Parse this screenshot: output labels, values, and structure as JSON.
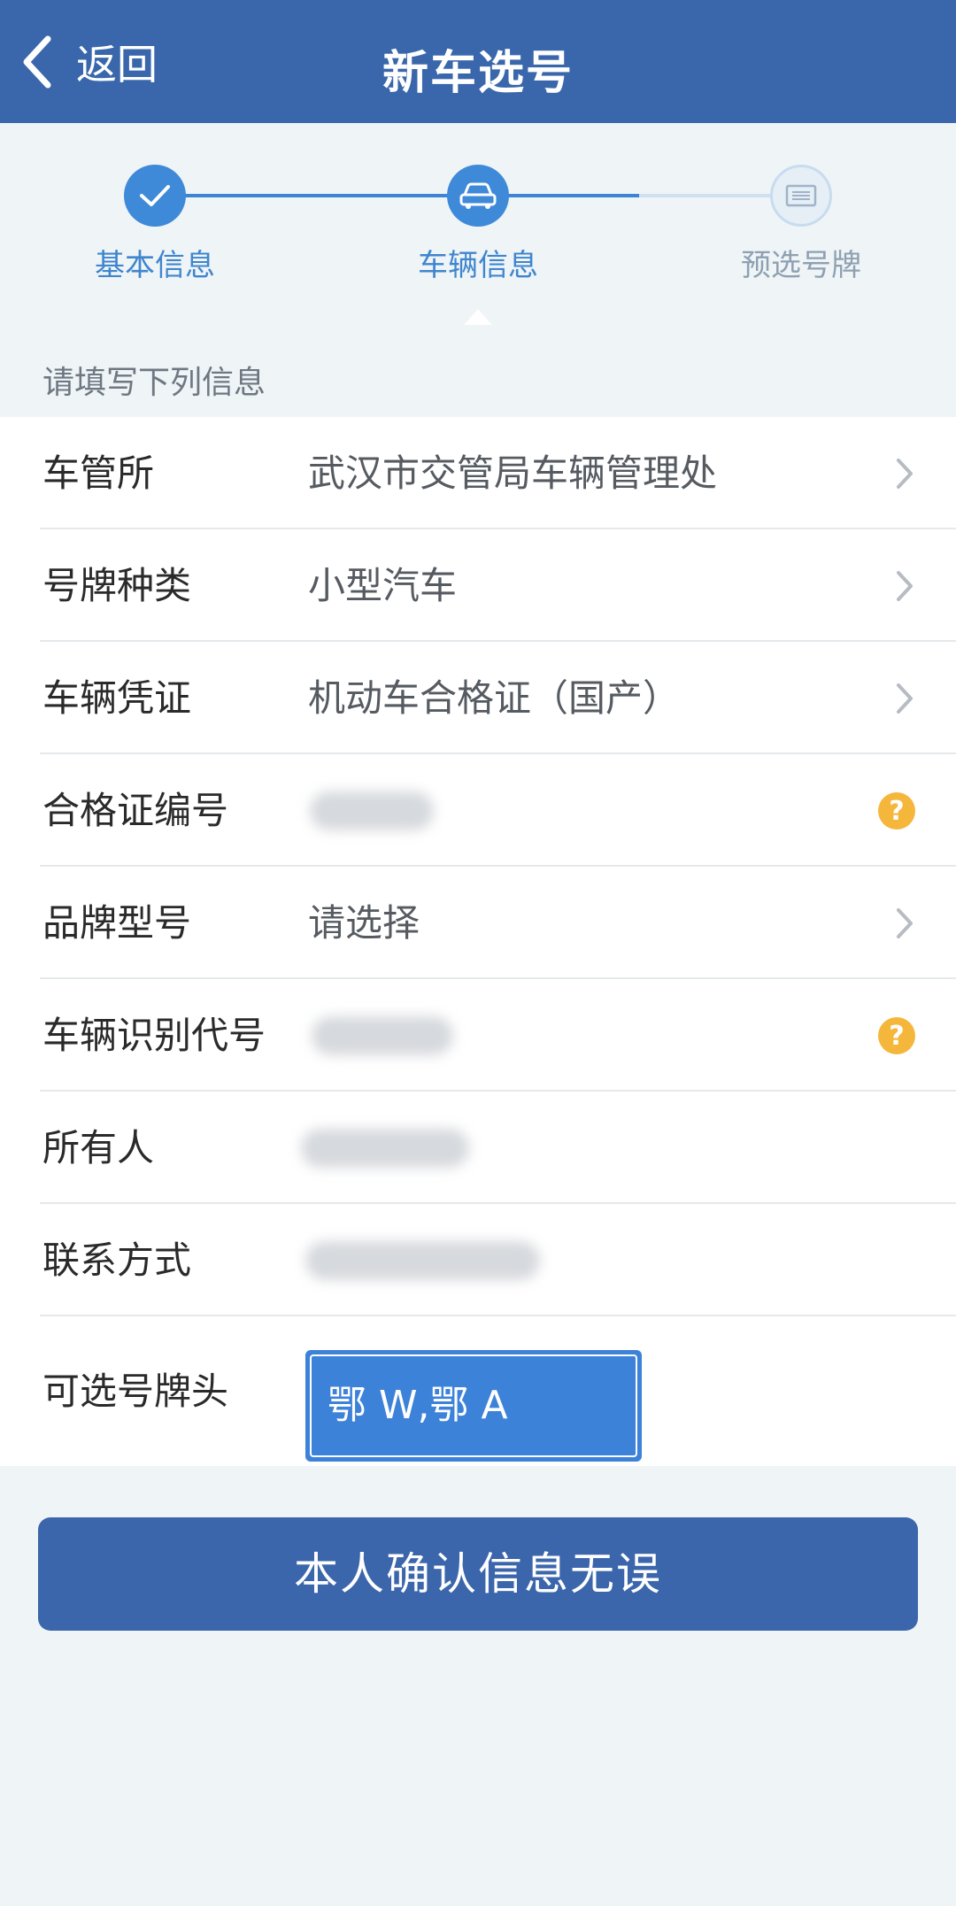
{
  "header": {
    "back_label": "返回",
    "title": "新车选号"
  },
  "steps": [
    {
      "label": "基本信息",
      "state": "done"
    },
    {
      "label": "车辆信息",
      "state": "current"
    },
    {
      "label": "预选号牌",
      "state": "pending"
    }
  ],
  "section_hint": "请填写下列信息",
  "form": {
    "rows": [
      {
        "label": "车管所",
        "value": "武汉市交管局车辆管理处"
      },
      {
        "label": "号牌种类",
        "value": "小型汽车"
      },
      {
        "label": "车辆凭证",
        "value": "机动车合格证（国产）"
      },
      {
        "label": "合格证编号"
      },
      {
        "label": "品牌型号",
        "value": "请选择"
      },
      {
        "label": "车辆识别代号"
      },
      {
        "label": "所有人"
      },
      {
        "label": "联系方式"
      },
      {
        "label": "可选号牌头",
        "value": "鄂 W,鄂 A"
      }
    ]
  },
  "confirm_label": "本人确认信息无误",
  "colors": {
    "header": "#3a67ab",
    "accent": "#3f8ad8",
    "help": "#f5b73b",
    "background": "#eff4f7"
  }
}
